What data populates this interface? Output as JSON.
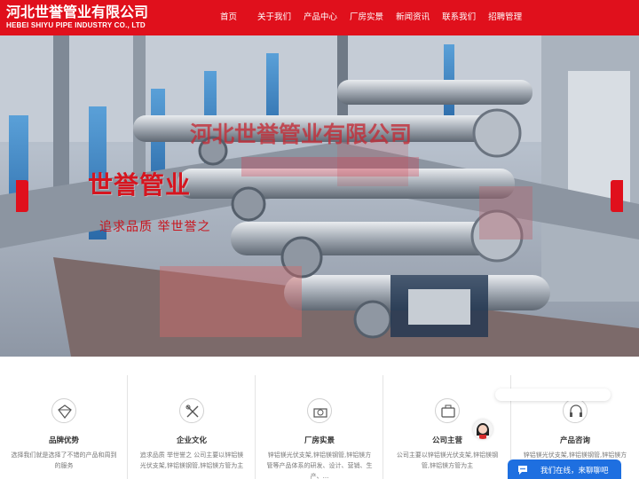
{
  "header": {
    "logo_cn": "河北世誉管业有限公司",
    "logo_en": "HEBEI SHIYU PIPE INDUSTRY CO., LTD",
    "nav": [
      "首页",
      "关于我们",
      "产品中心",
      "厂房实景",
      "新闻资讯",
      "联系我们",
      "招聘管理"
    ]
  },
  "hero": {
    "title": "世誉管业",
    "company": "河北世誉管业有限公司",
    "slogan": "追求品质 举世誉之"
  },
  "features": [
    {
      "title": "品牌优势",
      "desc": "选择我们就是选择了不错的产品和周到的服务",
      "icon": "diamond-icon"
    },
    {
      "title": "企业文化",
      "desc": "追求品质 举世誉之 公司主要以锌铝镁光伏支架,锌铝镁钢管,锌铝镁方管为主",
      "icon": "tools-icon"
    },
    {
      "title": "厂房实景",
      "desc": "锌铝镁光伏支架,锌铝镁钢管,锌铝镁方管等产品体系的研发、设计、营销、生产、...",
      "icon": "factory-icon"
    },
    {
      "title": "公司主营",
      "desc": "公司主要以锌铝镁光伏支架,锌铝镁钢管,锌铝镁方管为主",
      "icon": "briefcase-icon"
    },
    {
      "title": "产品咨询",
      "desc": "锌铝镁光伏支架,锌铝镁钢管,锌铝镁方管,锌铝镁",
      "icon": "headset-icon"
    }
  ],
  "chat": {
    "label": "我们在线，来聊聊吧"
  },
  "colors": {
    "brand_red": "#e0101c",
    "chat_blue": "#1e6fe0"
  }
}
